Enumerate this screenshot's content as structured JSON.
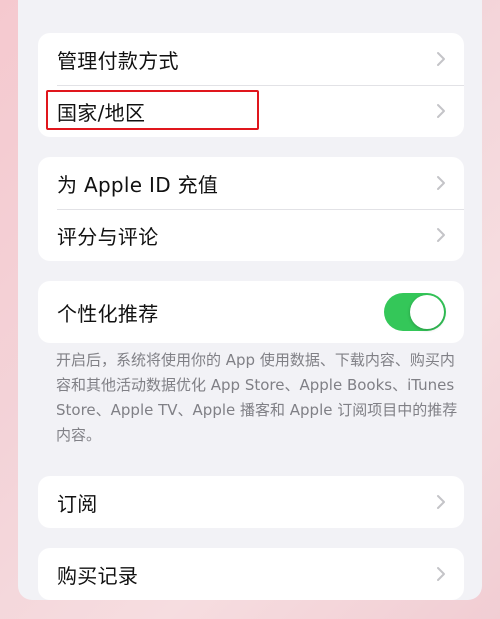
{
  "group1": {
    "items": [
      {
        "label": "管理付款方式"
      },
      {
        "label": "国家/地区"
      }
    ]
  },
  "group2": {
    "items": [
      {
        "label": "为 Apple ID 充值"
      },
      {
        "label": "评分与评论"
      }
    ]
  },
  "personalized": {
    "label": "个性化推荐",
    "toggle_on": true,
    "toggle_color": "#34c759",
    "footnote": "开启后，系统将使用你的 App 使用数据、下载内容、购买内容和其他活动数据优化 App Store、Apple Books、iTunes Store、Apple TV、Apple 播客和 Apple 订阅项目中的推荐内容。"
  },
  "group4": {
    "items": [
      {
        "label": "订阅"
      }
    ]
  },
  "group5": {
    "items": [
      {
        "label": "购买记录"
      }
    ]
  },
  "annotation": {
    "highlight_color": "#e0161d"
  }
}
